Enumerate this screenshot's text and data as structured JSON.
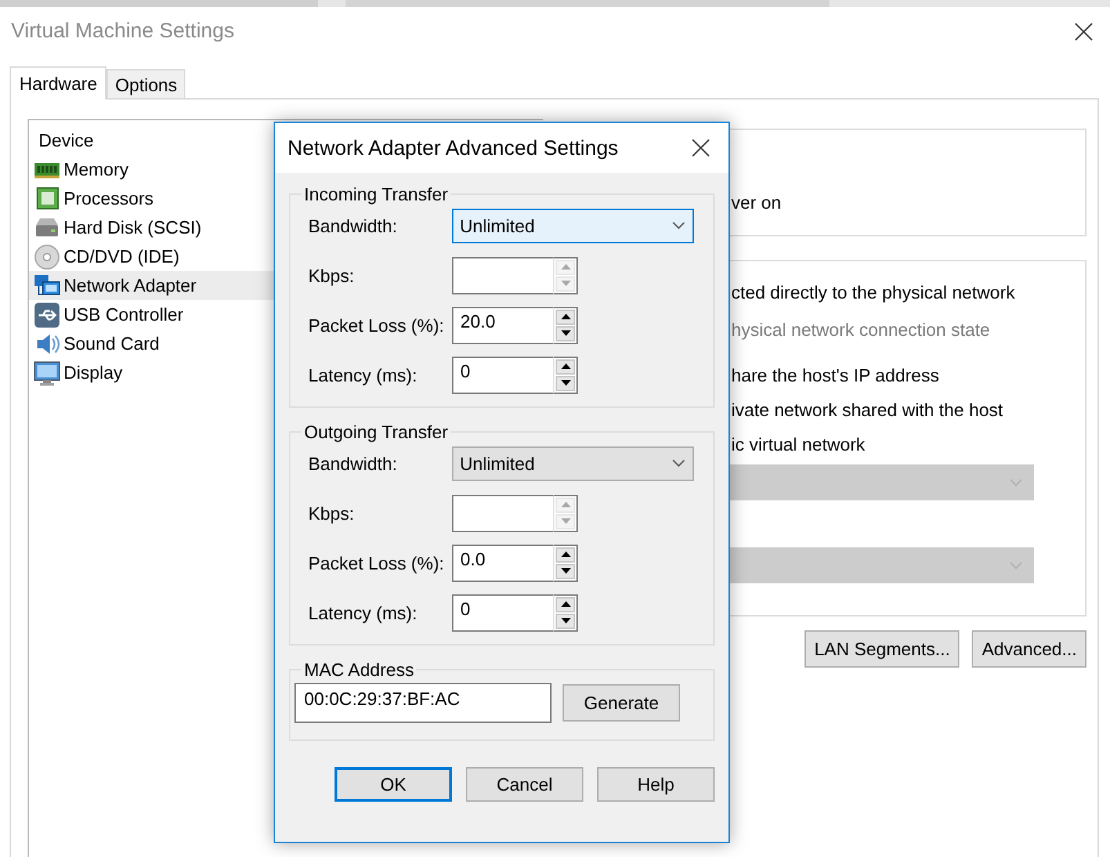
{
  "window": {
    "title": "Virtual Machine Settings"
  },
  "tabs": [
    {
      "label": "Hardware",
      "selected": true
    },
    {
      "label": "Options",
      "selected": false
    }
  ],
  "device_list": {
    "columns": [
      "Device"
    ],
    "rows": [
      {
        "kind": "memory",
        "name": "Memory",
        "selected": false
      },
      {
        "kind": "processor",
        "name": "Processors",
        "selected": false
      },
      {
        "kind": "disk",
        "name": "Hard Disk (SCSI)",
        "selected": false
      },
      {
        "kind": "cd",
        "name": "CD/DVD (IDE)",
        "selected": false
      },
      {
        "kind": "network",
        "name": "Network Adapter",
        "selected": true
      },
      {
        "kind": "usb",
        "name": "USB Controller",
        "selected": false
      },
      {
        "kind": "sound",
        "name": "Sound Card",
        "selected": false
      },
      {
        "kind": "display",
        "name": "Display",
        "selected": false
      }
    ]
  },
  "device_status": {
    "lines": [
      {
        "text": "ver on",
        "disabled": false
      }
    ]
  },
  "network_connection": {
    "lines": [
      {
        "text": "cted directly to the physical network",
        "disabled": false
      },
      {
        "text": "hysical network connection state",
        "disabled": true
      },
      {
        "text": "hare the host's IP address",
        "disabled": false
      },
      {
        "text": "ivate network shared with the host",
        "disabled": false
      },
      {
        "text": "ic virtual network",
        "disabled": false
      }
    ],
    "dropdowns": [
      {
        "disabled": true
      },
      {
        "disabled": true
      }
    ]
  },
  "panel_buttons": [
    "LAN Segments...",
    "Advanced..."
  ],
  "dialog": {
    "title": "Network Adapter Advanced Settings",
    "groups": [
      {
        "title": "Incoming Transfer",
        "bandwidth": {
          "label": "Bandwidth:",
          "value": "Unlimited",
          "focused": true
        },
        "fields": [
          {
            "label": "Kbps:",
            "disabled": true
          },
          {
            "label": "Packet Loss (%):",
            "value": "20.0",
            "disabled": false
          },
          {
            "label": "Latency (ms):",
            "value": "0",
            "disabled": false
          }
        ]
      },
      {
        "title": "Outgoing Transfer",
        "bandwidth": {
          "label": "Bandwidth:",
          "value": "Unlimited",
          "focused": false
        },
        "fields": [
          {
            "label": "Kbps:",
            "disabled": true
          },
          {
            "label": "Packet Loss (%):",
            "value": "0.0",
            "disabled": false
          },
          {
            "label": "Latency (ms):",
            "value": "0",
            "disabled": false
          }
        ]
      }
    ],
    "mac": {
      "title": "MAC Address",
      "value": "00:0C:29:37:BF:AC",
      "button": "Generate"
    },
    "buttons": [
      {
        "label": "OK",
        "default": true
      },
      {
        "label": "Cancel",
        "default": false
      },
      {
        "label": "Help",
        "default": false
      }
    ]
  }
}
